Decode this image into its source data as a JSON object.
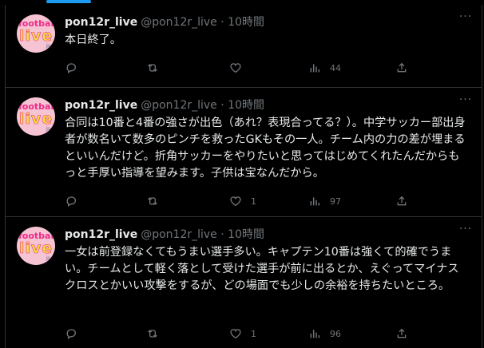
{
  "tweets": [
    {
      "author_name": "pon12r_live",
      "handle": "@pon12r_live",
      "separator": "·",
      "time": "10時間",
      "text": "本日終了。",
      "replies": "",
      "retweets": "",
      "likes": "",
      "views": "44",
      "avatar": {
        "line1": "football",
        "line2": "live",
        "line3": "jp"
      }
    },
    {
      "author_name": "pon12r_live",
      "handle": "@pon12r_live",
      "separator": "·",
      "time": "10時間",
      "text": "合同は10番と4番の強さが出色（あれ？表現合ってる？）。中学サッカー部出身者が数名いて数多のピンチを救ったGKもその一人。チーム内の力の差が埋まるといいんだけど。折角サッカーをやりたいと思ってはじめてくれたんだからもっと手厚い指導を望みます。子供は宝なんだから。",
      "replies": "",
      "retweets": "",
      "likes": "1",
      "views": "97",
      "avatar": {
        "line1": "football",
        "line2": "live",
        "line3": "jp"
      }
    },
    {
      "author_name": "pon12r_live",
      "handle": "@pon12r_live",
      "separator": "·",
      "time": "10時間",
      "text": "一女は前登録なくてもうまい選手多い。キャプテン10番は強くて的確でうまい。チームとして軽く落として受けた選手が前に出るとか、えぐってマイナスクロスとかいい攻撃をするが、どの場面でも少しの余裕を持ちたいところ。",
      "replies": "",
      "retweets": "",
      "likes": "1",
      "views": "96",
      "avatar": {
        "line1": "football",
        "line2": "live",
        "line3": "jp"
      }
    }
  ],
  "icons": {
    "reply": "reply-icon",
    "retweet": "retweet-icon",
    "like": "like-icon",
    "views": "views-icon",
    "share": "share-icon",
    "more": "more-icon"
  },
  "colors": {
    "background": "#000000",
    "text": "#e7e9ea",
    "secondary": "#71767b",
    "border": "#2f3336",
    "accent": "#1d9bf0"
  }
}
